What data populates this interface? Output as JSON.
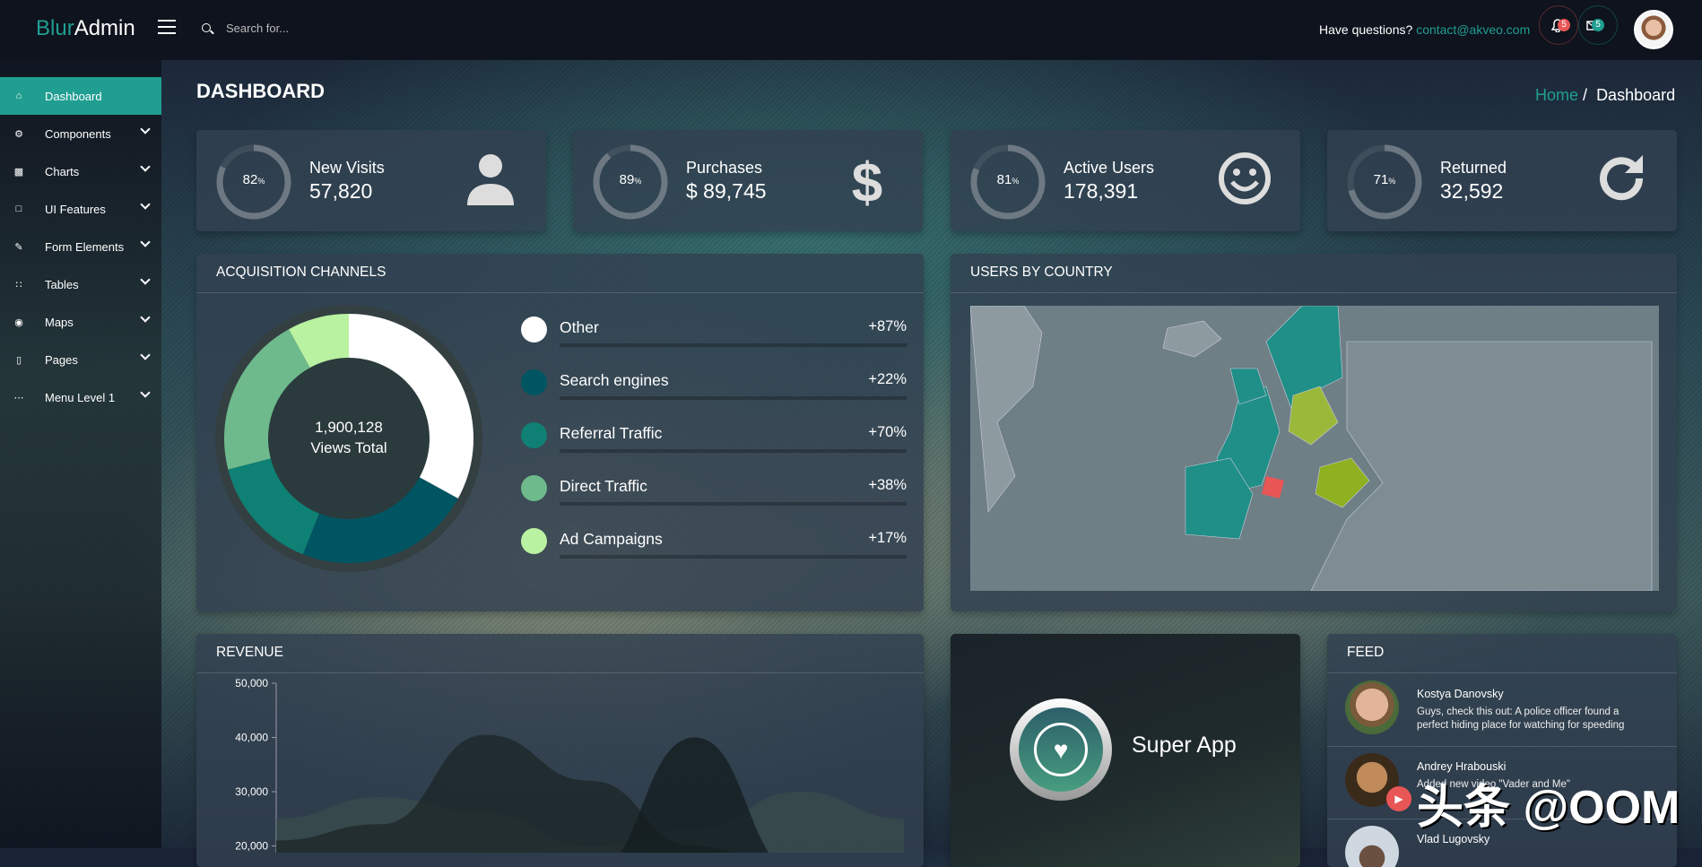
{
  "header": {
    "logo_part1": "Blur",
    "logo_part2": "Admin",
    "search_placeholder": "Search for...",
    "questions": "Have questions?",
    "email": "contact@akveo.com",
    "notifications_count": "5",
    "messages_count": "5"
  },
  "sidebar": {
    "items": [
      {
        "label": "Dashboard",
        "icon": "home"
      },
      {
        "label": "Components",
        "icon": "gear"
      },
      {
        "label": "Charts",
        "icon": "bar-chart"
      },
      {
        "label": "UI Features",
        "icon": "laptop"
      },
      {
        "label": "Form Elements",
        "icon": "edit"
      },
      {
        "label": "Tables",
        "icon": "grid"
      },
      {
        "label": "Maps",
        "icon": "map-pin"
      },
      {
        "label": "Pages",
        "icon": "file"
      },
      {
        "label": "Menu Level 1",
        "icon": "ellipsis"
      }
    ]
  },
  "page": {
    "title": "DASHBOARD",
    "breadcrumb_home": "Home",
    "breadcrumb_sep": "/",
    "breadcrumb_current": "Dashboard"
  },
  "stats": [
    {
      "percent": "82",
      "label": "New Visits",
      "value": "57,820",
      "icon": "user"
    },
    {
      "percent": "89",
      "label": "Purchases",
      "value": "$ 89,745",
      "icon": "dollar"
    },
    {
      "percent": "81",
      "label": "Active Users",
      "value": "178,391",
      "icon": "smile"
    },
    {
      "percent": "71",
      "label": "Returned",
      "value": "32,592",
      "icon": "refresh"
    }
  ],
  "acquisition": {
    "title": "ACQUISITION CHANNELS",
    "total": "1,900,128",
    "total_label": "Views Total",
    "channels": [
      {
        "name": "Other",
        "change": "+87%",
        "color": "#ffffff",
        "share": 0.33
      },
      {
        "name": "Search engines",
        "change": "+22%",
        "color": "#005562",
        "share": 0.23
      },
      {
        "name": "Referral Traffic",
        "change": "+70%",
        "color": "#0e8174",
        "share": 0.15
      },
      {
        "name": "Direct Traffic",
        "change": "+38%",
        "color": "#6eba8c",
        "share": 0.21
      },
      {
        "name": "Ad Campaigns",
        "change": "+17%",
        "color": "#b9f2a1",
        "share": 0.08
      }
    ]
  },
  "map": {
    "title": "USERS BY COUNTRY"
  },
  "revenue": {
    "title": "REVENUE",
    "chart_data": {
      "type": "area",
      "ylim": [
        20000,
        50000
      ],
      "yticks": [
        "50,000",
        "40,000",
        "30,000",
        "20,000"
      ],
      "series": [
        {
          "values": [
            25000,
            29000,
            26000,
            20000,
            23000,
            30000,
            25000
          ]
        },
        {
          "values": [
            21000,
            24000,
            40500,
            32000,
            20000,
            15000,
            15000
          ]
        },
        {
          "values": [
            15000,
            15000,
            15000,
            15000,
            40000,
            15000,
            15000
          ]
        }
      ]
    }
  },
  "app": {
    "name": "Super App",
    "icon": "heart"
  },
  "feed": {
    "title": "FEED",
    "items": [
      {
        "name": "Kostya Danovsky",
        "text": "Guys, check this out: A police officer found a perfect hiding place for watching for speeding"
      },
      {
        "name": "Andrey Hrabouski",
        "text": "Added new video \"Vader and Me\""
      },
      {
        "name": "Vlad Lugovsky",
        "text": ""
      }
    ]
  },
  "watermark": "头条 @OOM",
  "colors": {
    "accent": "#209e91",
    "danger": "#e85656"
  }
}
